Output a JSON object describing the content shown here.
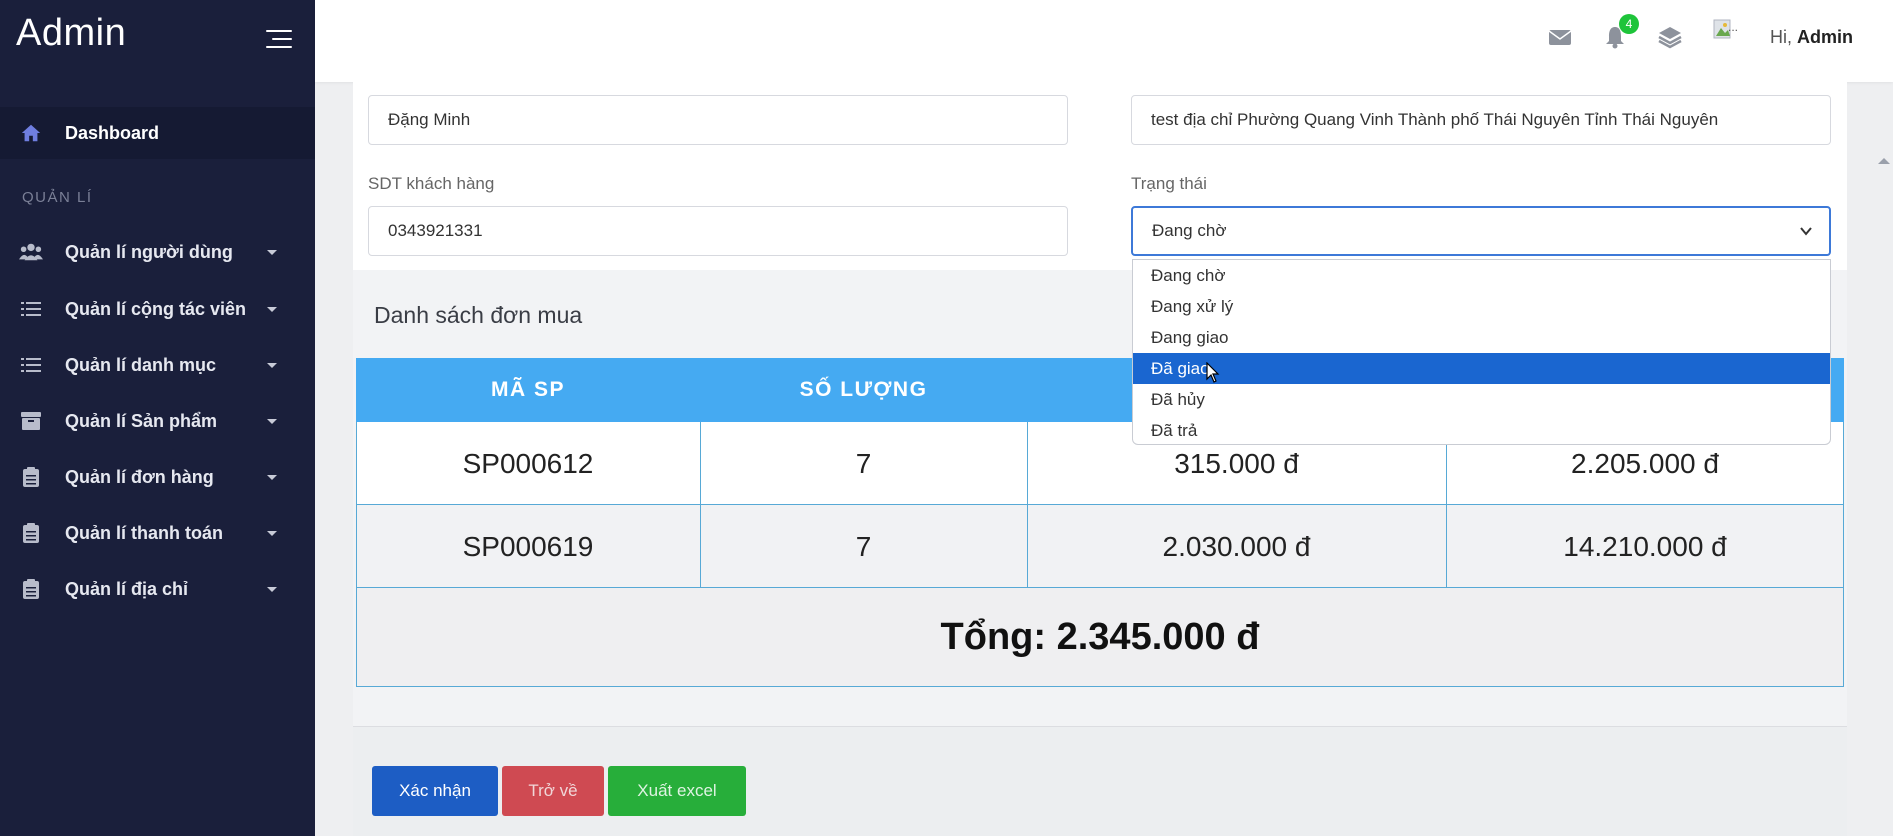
{
  "brand": "Admin",
  "sidebar": {
    "dashboard": "Dashboard",
    "section": "QUẢN LÍ",
    "items": [
      {
        "label": "Quản lí người dùng",
        "icon": "users-icon"
      },
      {
        "label": "Quản lí cộng tác viên",
        "icon": "list-icon"
      },
      {
        "label": "Quản lí danh mục",
        "icon": "list-icon"
      },
      {
        "label": "Quản lí Sản phẩm",
        "icon": "box-icon"
      },
      {
        "label": "Quản lí đơn hàng",
        "icon": "clipboard-icon"
      },
      {
        "label": "Quản lí thanh toán",
        "icon": "clipboard-icon"
      },
      {
        "label": "Quản lí địa chỉ",
        "icon": "clipboard-icon"
      }
    ]
  },
  "topbar": {
    "notification_count": "4",
    "avatar_alt": "...",
    "greeting": "Hi,",
    "user": "Admin"
  },
  "form": {
    "customer_name": "Đặng Minh",
    "address": "test địa chỉ Phường Quang Vinh Thành phố Thái Nguyên Tỉnh Thái Nguyên",
    "phone_label": "SDT khách hàng",
    "phone": "0343921331",
    "status_label": "Trạng thái",
    "status_value": "Đang chờ"
  },
  "dropdown": {
    "options": [
      "Đang chờ",
      "Đang xử lý",
      "Đang giao",
      "Đã giao",
      "Đã hủy",
      "Đã trả"
    ],
    "highlighted": "Đã giao"
  },
  "orders": {
    "title": "Danh sách đơn mua",
    "headers": [
      "MÃ SP",
      "SỐ LƯỢNG"
    ],
    "rows": [
      {
        "code": "SP000612",
        "qty": "7",
        "price": "315.000 đ",
        "subtotal": "2.205.000 đ"
      },
      {
        "code": "SP000619",
        "qty": "7",
        "price": "2.030.000 đ",
        "subtotal": "14.210.000 đ"
      }
    ],
    "total": "Tổng: 2.345.000 đ"
  },
  "buttons": {
    "confirm": "Xác nhận",
    "back": "Trở về",
    "excel": "Xuất excel"
  },
  "colors": {
    "sidebar_bg": "#1a1f3b",
    "table_header": "#45aaf2",
    "confirm": "#1d5dc4",
    "back": "#cf4a52",
    "excel": "#27ae3a",
    "dropdown_active": "#1a66d0"
  }
}
